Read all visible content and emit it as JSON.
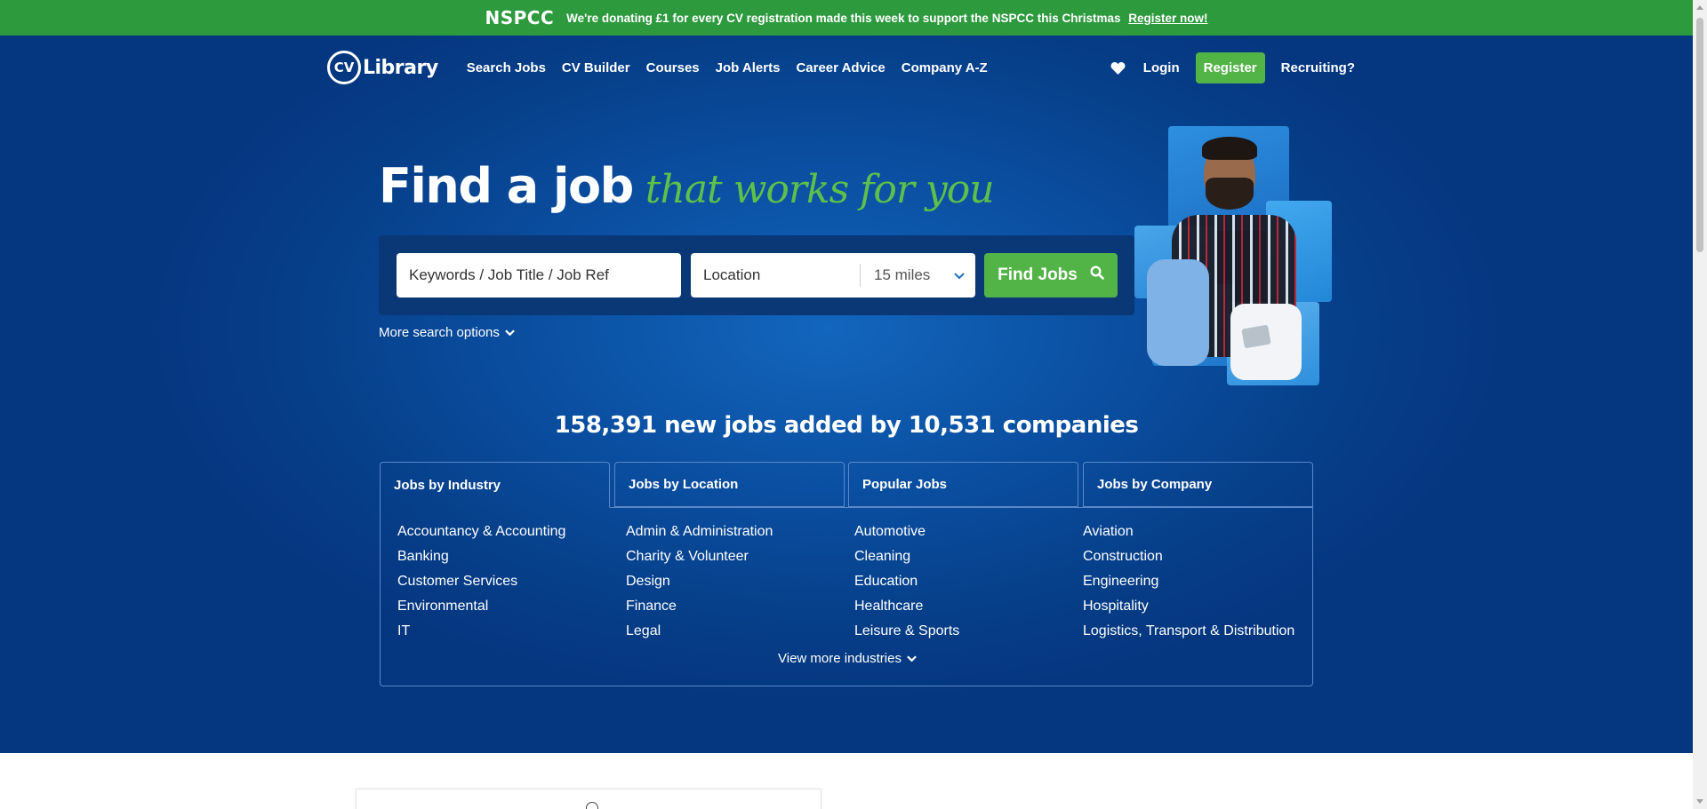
{
  "banner": {
    "logo": "NSPCC",
    "text": "We're donating £1 for every CV registration made this week to support the NSPCC this Christmas",
    "link": "Register now!",
    "bg_color": "#2e9a3e"
  },
  "nav": {
    "logo_mark": "CV",
    "logo_word": "Library",
    "links": [
      "Search Jobs",
      "CV Builder",
      "Courses",
      "Job Alerts",
      "Career Advice",
      "Company A-Z"
    ],
    "favourites_icon": "heart-icon",
    "login": "Login",
    "register": "Register",
    "recruiting": "Recruiting?"
  },
  "hero": {
    "headline_main": "Find a job",
    "headline_accent": "that works for you",
    "accent_color": "#5dc04a"
  },
  "search": {
    "keywords_placeholder": "Keywords / Job Title / Job Ref",
    "location_placeholder": "Location",
    "radius_value": "15 miles",
    "find_button": "Find Jobs",
    "more_options": "More search options",
    "button_color": "#52b447"
  },
  "stats": {
    "text": "158,391 new jobs added by 10,531 companies"
  },
  "tabs": [
    {
      "label": "Jobs by Industry",
      "active": true
    },
    {
      "label": "Jobs by Location",
      "active": false
    },
    {
      "label": "Popular Jobs",
      "active": false
    },
    {
      "label": "Jobs by Company",
      "active": false
    }
  ],
  "industries": {
    "columns": [
      [
        "Accountancy & Accounting",
        "Banking",
        "Customer Services",
        "Environmental",
        "IT"
      ],
      [
        "Admin & Administration",
        "Charity & Volunteer",
        "Design",
        "Finance",
        "Legal"
      ],
      [
        "Automotive",
        "Cleaning",
        "Education",
        "Healthcare",
        "Leisure & Sports"
      ],
      [
        "Aviation",
        "Construction",
        "Engineering",
        "Hospitality",
        "Logistics, Transport & Distribution"
      ]
    ],
    "view_more": "View more industries"
  }
}
